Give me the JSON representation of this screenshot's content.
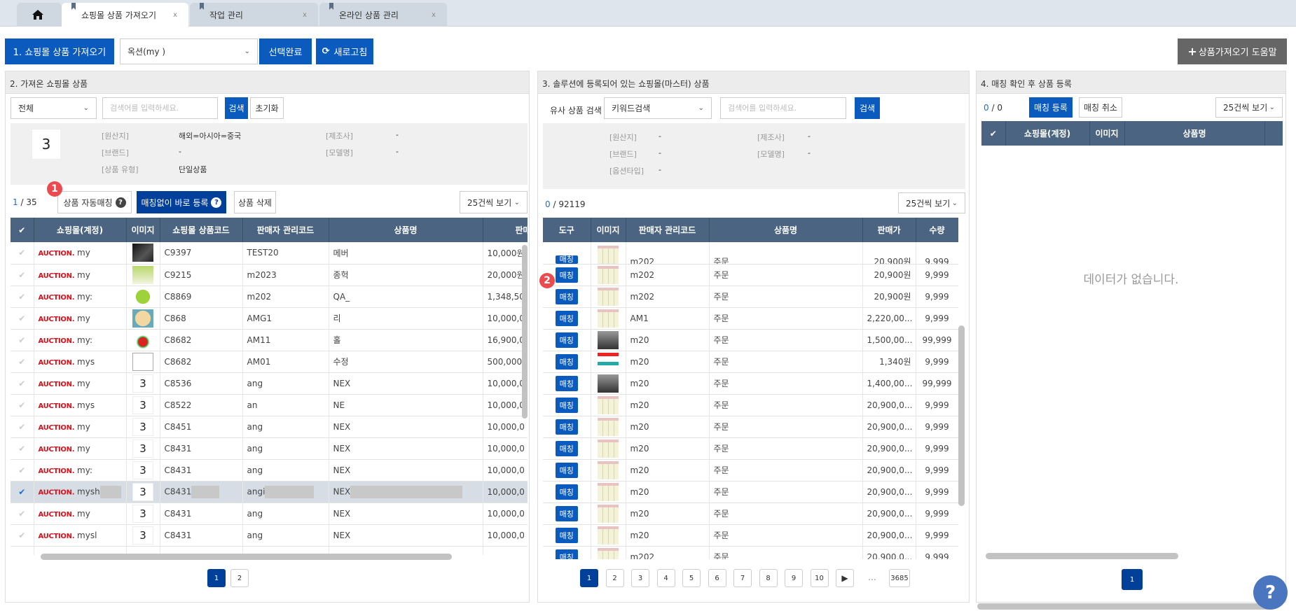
{
  "tabs": [
    {
      "label": "쇼핑몰 상품 가져오기",
      "active": true
    },
    {
      "label": "작업 관리"
    },
    {
      "label": "온라인 상품 관리"
    }
  ],
  "toolbar": {
    "fetch_label": "1. 쇼핑몰 상품 가져오기",
    "account_select": "옥션(my            )",
    "confirm_label": "선택완료",
    "refresh_label": "새로고침",
    "help_label": "상품가져오기 도움말"
  },
  "panel1": {
    "title": "2. 가져온 쇼핑몰 상품",
    "filter_select": "전체",
    "search_placeholder": "검색어를 입력하세요.",
    "search_label": "검색",
    "reset_label": "초기화",
    "info": {
      "thumb_text": "3",
      "origin_label": "[원산지]",
      "origin": "해외=아시아=중국",
      "maker_label": "[제조사]",
      "maker": "-",
      "brand_label": "[브랜드]",
      "brand": "-",
      "model_label": "[모델명]",
      "model": "-",
      "type_label": "[상품 유형]",
      "type": "단일상품"
    },
    "count_selected": "1",
    "count_total": "/ 35",
    "auto_match_label": "상품 자동매칭",
    "direct_register_label": "매칭없이 바로 등록",
    "delete_label": "상품 삭제",
    "page_size": "25건씩 보기",
    "columns": [
      "✔",
      "쇼핑몰(계정)",
      "이미지",
      "쇼핑몰 상품코드",
      "판매자 관리코드",
      "상품명",
      "판매가"
    ],
    "rows": [
      {
        "mall": "AUCTION.",
        "account": "my",
        "img": "dark",
        "code": "C9397",
        "seller": "TEST20",
        "name": "메버",
        "price": "10,000원"
      },
      {
        "mall": "AUCTION.",
        "account": "my",
        "img": "card",
        "code": "C9215",
        "seller": "m2023",
        "name": "종헉",
        "price": "20,000원"
      },
      {
        "mall": "AUCTION.",
        "account": "my:",
        "img": "six",
        "code": "C8869",
        "seller": "m202",
        "name": "QA_",
        "price": "1,348,50"
      },
      {
        "mall": "AUCTION.",
        "account": "my",
        "img": "cartoon",
        "code": "C868",
        "seller": "AMG1",
        "name": "리",
        "price": "10,000,0"
      },
      {
        "mall": "AUCTION.",
        "account": "my:",
        "img": "flower",
        "code": "C8682",
        "seller": "AM11",
        "name": "홀",
        "price": "16,900,0"
      },
      {
        "mall": "AUCTION.",
        "account": "mys",
        "img": "broken",
        "code": "C8682",
        "seller": "AM01",
        "name": "수정",
        "price": "500,000"
      },
      {
        "mall": "AUCTION.",
        "account": "my",
        "img": "3",
        "code": "C8536",
        "seller": "ang",
        "name": "NEX",
        "price": "10,000,0"
      },
      {
        "mall": "AUCTION.",
        "account": "mys",
        "img": "3",
        "code": "C8522",
        "seller": "an",
        "name": "NE",
        "price": "10,000,0"
      },
      {
        "mall": "AUCTION.",
        "account": "my",
        "img": "3",
        "code": "C8451",
        "seller": "ang",
        "name": "NEX",
        "price": "10,000,0"
      },
      {
        "mall": "AUCTION.",
        "account": "my",
        "img": "3",
        "code": "C8431",
        "seller": "ang",
        "name": "NEX",
        "price": "10,000,0"
      },
      {
        "mall": "AUCTION.",
        "account": "my:",
        "img": "3",
        "code": "C8431",
        "seller": "ang",
        "name": "NEX",
        "price": "10,000,0"
      },
      {
        "mall": "AUCTION.",
        "account": "mysh",
        "img": "3",
        "code": "C8431",
        "seller": "angi",
        "name": "NEX",
        "price": "10,000,0",
        "selected": true
      },
      {
        "mall": "AUCTION.",
        "account": "my",
        "img": "3",
        "code": "C8431",
        "seller": "ang",
        "name": "NEX",
        "price": "10,000,0"
      },
      {
        "mall": "AUCTION.",
        "account": "mysl",
        "img": "3",
        "code": "C8431",
        "seller": "ang",
        "name": "NEX",
        "price": "10,000,0"
      }
    ],
    "pages": [
      "1",
      "2"
    ]
  },
  "panel2": {
    "title": "3. 솔루션에 등록되어 있는 쇼핑몰(마스터) 상품",
    "criteria_label": "유사 상품 검색 기준",
    "criteria_select": "키워드검색",
    "search_placeholder": "검색어를 입력하세요.",
    "search_label": "검색",
    "info": {
      "origin_label": "[원산지]",
      "origin": "-",
      "maker_label": "[제조사]",
      "maker": "-",
      "brand_label": "[브랜드]",
      "brand": "-",
      "model_label": "[모델명]",
      "model": "-",
      "option_label": "[옵션타입]",
      "option": "-"
    },
    "count_selected": "0",
    "count_total": "/ 92119",
    "page_size": "25건씩 보기",
    "columns": [
      "도구",
      "이미지",
      "판매자 관리코드",
      "상품명",
      "판매가",
      "수량"
    ],
    "match_label": "매칭",
    "rows": [
      {
        "img": "milk",
        "seller": "m202",
        "name": "주문",
        "price": "20,900원",
        "qty": "9,999"
      },
      {
        "img": "milk",
        "seller": "m202",
        "name": "주문",
        "price": "20,900원",
        "qty": "9,999"
      },
      {
        "img": "milk",
        "seller": "m202",
        "name": "주문",
        "price": "20,900원",
        "qty": "9,999"
      },
      {
        "img": "milk",
        "seller": "AM1",
        "name": "주문",
        "price": "2,220,00...",
        "qty": "9,999"
      },
      {
        "img": "photo",
        "seller": "m20",
        "name": "주문",
        "price": "1,500,00...",
        "qty": "99,999"
      },
      {
        "img": "tool",
        "seller": "m20",
        "name": "주문",
        "price": "1,340원",
        "qty": "9,999"
      },
      {
        "img": "photo",
        "seller": "m20",
        "name": "주문",
        "price": "1,400,00...",
        "qty": "99,999"
      },
      {
        "img": "milk",
        "seller": "m20",
        "name": "주문",
        "price": "20,900,0...",
        "qty": "9,999"
      },
      {
        "img": "milk",
        "seller": "m20",
        "name": "주문",
        "price": "20,900,0...",
        "qty": "9,999"
      },
      {
        "img": "milk",
        "seller": "m20",
        "name": "주문",
        "price": "20,900,0...",
        "qty": "9,999"
      },
      {
        "img": "milk",
        "seller": "m20",
        "name": "주문",
        "price": "20,900,0...",
        "qty": "9,999"
      },
      {
        "img": "milk",
        "seller": "m20",
        "name": "주문",
        "price": "20,900,0...",
        "qty": "9,999"
      },
      {
        "img": "milk",
        "seller": "m20",
        "name": "주문",
        "price": "20,900,0...",
        "qty": "9,999"
      },
      {
        "img": "milk",
        "seller": "m20",
        "name": "주문",
        "price": "20,900,0...",
        "qty": "9,999"
      },
      {
        "img": "milk",
        "seller": "m202",
        "name": "주문",
        "price": "20,900,0...",
        "qty": "9,999"
      }
    ],
    "pages": [
      "1",
      "2",
      "3",
      "4",
      "5",
      "6",
      "7",
      "8",
      "9",
      "10"
    ],
    "next": "▶",
    "ellipsis": "…",
    "last_page": "3685"
  },
  "panel3": {
    "title": "4. 매칭 확인 후 상품 등록",
    "count_selected": "0",
    "count_total": "/  0",
    "register_label": "매칭 등록",
    "cancel_label": "매칭 취소",
    "page_size": "25건씩 보기",
    "columns": [
      "✔",
      "쇼핑몰(계정)",
      "이미지",
      "상품명"
    ],
    "empty": "데이터가 없습니다.",
    "pages": [
      "1"
    ]
  },
  "annotations": [
    "1",
    "2"
  ],
  "fab": "?",
  "colors": {
    "primary": "#0b5bbf",
    "table_header": "#4b6482",
    "auction": "#d8111b",
    "badge": "#ea4b4f",
    "page_active": "#003f9a"
  }
}
